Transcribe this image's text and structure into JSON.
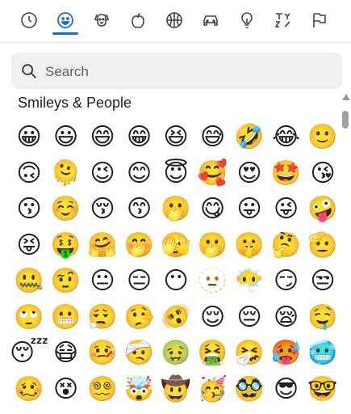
{
  "tabs": [
    {
      "name": "recent-icon",
      "active": false
    },
    {
      "name": "smiley-icon",
      "active": true
    },
    {
      "name": "animal-icon",
      "active": false
    },
    {
      "name": "apple-icon",
      "active": false
    },
    {
      "name": "ball-icon",
      "active": false
    },
    {
      "name": "car-icon",
      "active": false
    },
    {
      "name": "lightbulb-icon",
      "active": false
    },
    {
      "name": "symbols-icon",
      "active": false
    },
    {
      "name": "flag-icon",
      "active": false
    }
  ],
  "search": {
    "placeholder": "Search"
  },
  "section": {
    "title": "Smileys & People"
  },
  "accent": "#1a6bd6",
  "emojis": [
    "😀",
    "😃",
    "😄",
    "😁",
    "😆",
    "😅",
    "🤣",
    "😂",
    "🙂",
    "🙃",
    "🫠",
    "😉",
    "😊",
    "😇",
    "🥰",
    "😍",
    "🤩",
    "😘",
    "😗",
    "☺️",
    "😚",
    "😙",
    "🫢",
    "😋",
    "😛",
    "😜",
    "🤪",
    "😝",
    "🤑",
    "🤗",
    "🤭",
    "🫣",
    "🫢",
    "🤫",
    "🤔",
    "🫡",
    "🤐",
    "🤨",
    "😐",
    "😑",
    "😶",
    "🫥",
    "😶‍🌫️",
    "😏",
    "😒",
    "🙄",
    "😬",
    "😮‍💨",
    "🤥",
    "🫨",
    "😌",
    "😔",
    "😪",
    "🤤",
    "😴",
    "😷",
    "🤒",
    "🤕",
    "🤢",
    "🤮",
    "🤧",
    "🥵",
    "🥶",
    "🥴",
    "😵",
    "😵‍💫",
    "🤯",
    "🤠",
    "🥳",
    "🥸",
    "😎",
    "🤓"
  ]
}
